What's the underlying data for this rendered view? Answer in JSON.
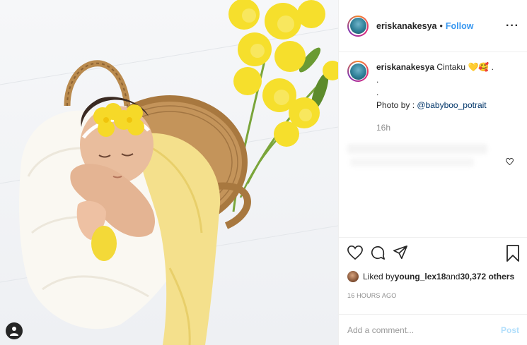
{
  "header": {
    "username": "eriskanakesya",
    "separator": "•",
    "follow_label": "Follow",
    "more_label": "···"
  },
  "caption": {
    "username": "eriskanakesya",
    "text": "Cintaku 💛🥰 .",
    "line2": ".",
    "line3": ".",
    "photo_credit_prefix": "Photo by : ",
    "photo_credit_mention": "@babyboo_potrait",
    "time": "16h"
  },
  "likes": {
    "prefix": "Liked by ",
    "liker": "young_lex18",
    "middle": " and ",
    "count": "30,372 others"
  },
  "timestamp": "16 HOURS AGO",
  "comment": {
    "placeholder": "Add a comment...",
    "post_label": "Post"
  },
  "icons": {
    "like": "heart-icon",
    "comment": "comment-icon",
    "share": "share-icon",
    "save": "bookmark-icon",
    "more": "more-icon",
    "tag": "user-tag-icon"
  },
  "colors": {
    "follow": "#3897f0",
    "mention": "#003569",
    "muted": "#8e8e8e",
    "post_disabled": "#b2dffc"
  }
}
